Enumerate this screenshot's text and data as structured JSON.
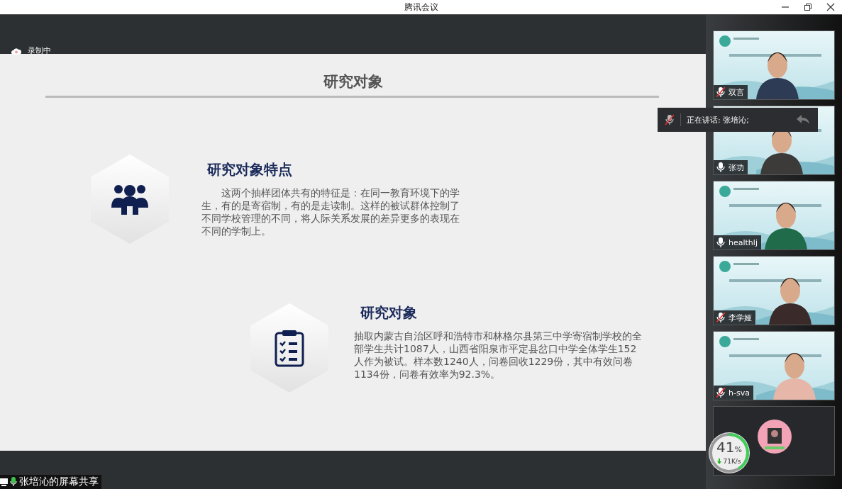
{
  "window": {
    "title": "腾讯会议"
  },
  "recording": {
    "label": "录制中"
  },
  "slide": {
    "title": "研究对象",
    "sections": [
      {
        "kind": "people",
        "heading": "研究对象特点",
        "text": "这两个抽样团体共有的特征是：在同一教育环境下的学生，有的是寄宿制，有的是走读制。这样的被试群体控制了不同学校管理的不同，将人际关系发展的差异更多的表现在不同的学制上。"
      },
      {
        "kind": "clipboard",
        "heading": "研究对象",
        "text": "抽取内蒙古自治区呼和浩特市和林格尔县第三中学寄宿制学校的全部学生共计1087人，山西省阳泉市平定县岔口中学全体学生152人作为被试。样本数1240人，问卷回收1229份，其中有效问卷1134份，问卷有效率为92.3%。"
      }
    ]
  },
  "speaking": {
    "label": "正在讲话: 张培沁;",
    "muted": true
  },
  "share_label": "张培沁的屏幕共享",
  "participants": [
    {
      "kind": "video",
      "name": "双言",
      "muted": true
    },
    {
      "kind": "video",
      "name": "张功",
      "muted": false
    },
    {
      "kind": "video",
      "name": "healthlj",
      "muted": false
    },
    {
      "kind": "video",
      "name": "李学娅",
      "muted": true
    },
    {
      "kind": "video",
      "name": "h-sva",
      "muted": true
    },
    {
      "kind": "avatar"
    }
  ],
  "network": {
    "level": 0.41,
    "percent": "41",
    "unit": "%",
    "speed": "71K/s"
  }
}
